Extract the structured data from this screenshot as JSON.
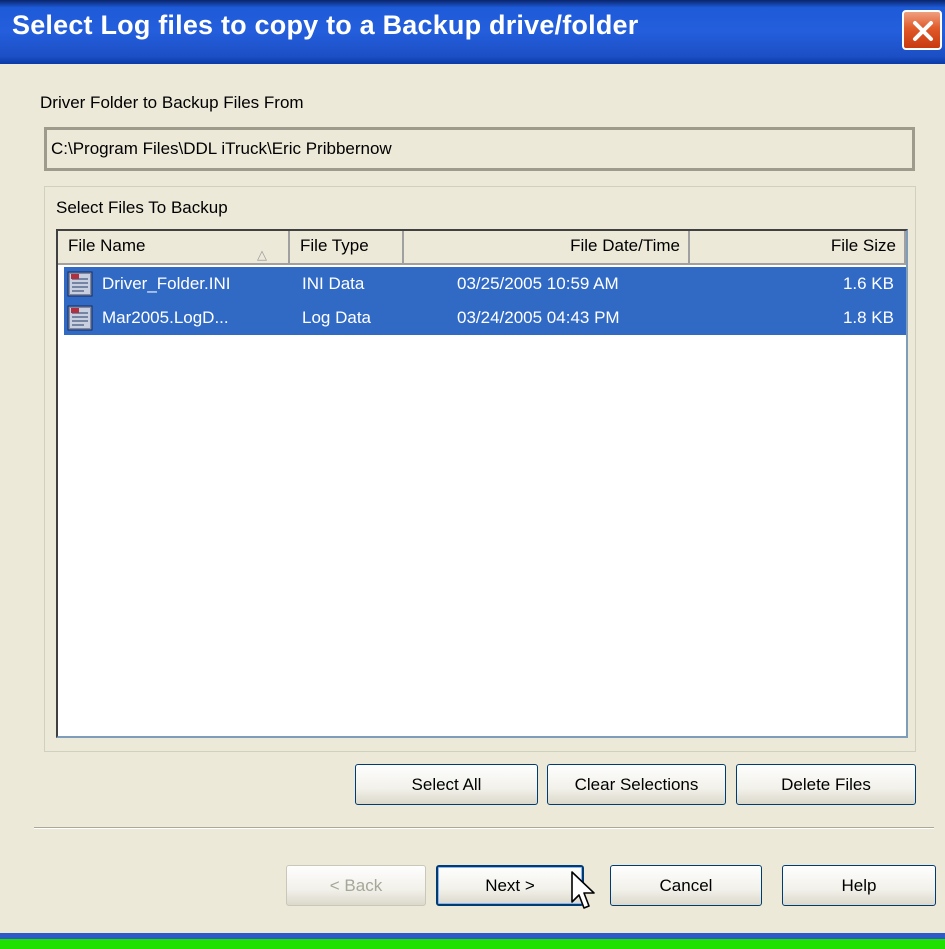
{
  "window": {
    "title": "Select Log files to copy to a Backup drive/folder"
  },
  "source": {
    "label": "Driver Folder to Backup Files From",
    "path": "C:\\Program Files\\DDL iTruck\\Eric Pribbernow"
  },
  "files_group": {
    "label": "Select Files To Backup",
    "columns": [
      "File Name",
      "File Type",
      "File Date/Time",
      "File Size"
    ],
    "rows": [
      {
        "name": "Driver_Folder.INI",
        "type": "INI Data",
        "datetime": "03/25/2005  10:59 AM",
        "size": "1.6 KB",
        "selected": true,
        "icon": "file-icon"
      },
      {
        "name": "Mar2005.LogD...",
        "type": "Log Data",
        "datetime": "03/24/2005  04:43 PM",
        "size": "1.8 KB",
        "selected": true,
        "icon": "file-icon"
      }
    ],
    "actions": {
      "select_all": "Select All",
      "clear_selections": "Clear Selections",
      "delete_files": "Delete Files"
    }
  },
  "wizard": {
    "back": "< Back",
    "next": "Next >",
    "cancel": "Cancel",
    "help": "Help"
  },
  "colors": {
    "selection": "#316AC5",
    "titlebar": "#245EDC",
    "dialog_bg": "#ECE9D8"
  }
}
